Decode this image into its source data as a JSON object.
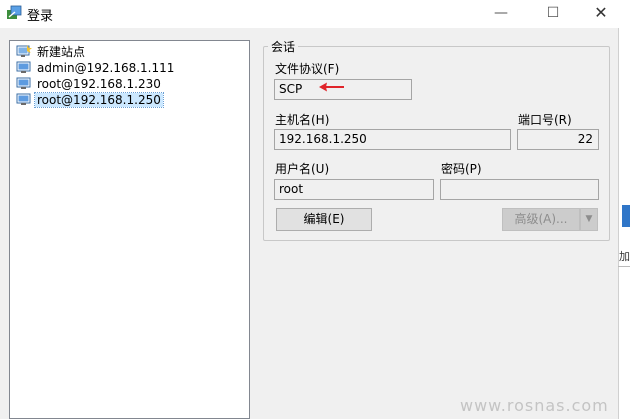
{
  "window": {
    "title": "登录",
    "minimize_glyph": "—",
    "maximize_glyph": "☐",
    "close_glyph": "✕"
  },
  "site_tree": {
    "items": [
      {
        "label": "新建站点",
        "icon": "new-site-icon",
        "selected": false
      },
      {
        "label": "admin@192.168.1.111",
        "icon": "monitor-icon",
        "selected": false
      },
      {
        "label": "root@192.168.1.230",
        "icon": "monitor-icon",
        "selected": false
      },
      {
        "label": "root@192.168.1.250",
        "icon": "monitor-icon",
        "selected": true
      }
    ]
  },
  "session": {
    "group_title": "会话",
    "protocol_label": "文件协议(F)",
    "protocol_value": "SCP",
    "host_label": "主机名(H)",
    "host_value": "192.168.1.250",
    "port_label": "端口号(R)",
    "port_value": "22",
    "user_label": "用户名(U)",
    "user_value": "root",
    "password_label": "密码(P)",
    "password_value": "",
    "edit_button": "编辑(E)",
    "advanced_button": "高级(A)...",
    "advanced_dropdown_glyph": "▼"
  },
  "edge": {
    "text": "加"
  },
  "watermark": "www.rosnas.com",
  "colors": {
    "selection": "#cce8ff",
    "arrow": "#e0242a",
    "edge_accent": "#2f76c8"
  }
}
